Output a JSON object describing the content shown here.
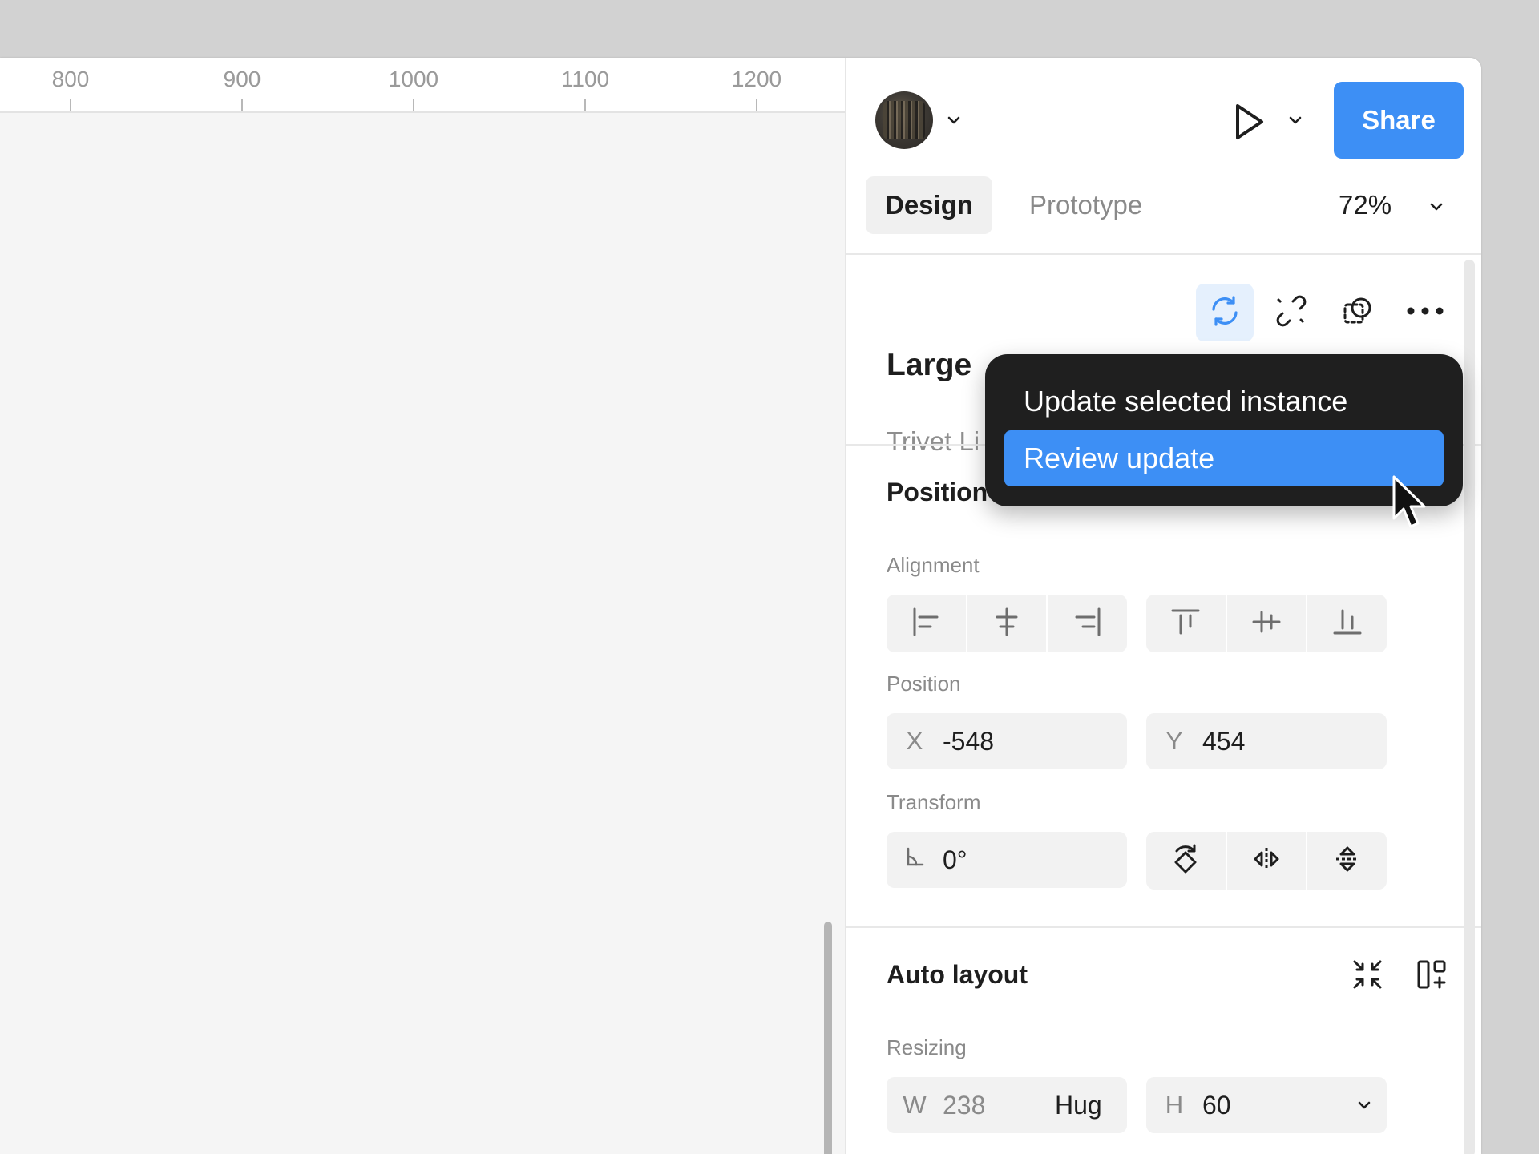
{
  "ruler": {
    "ticks": [
      "800",
      "900",
      "1000",
      "1100",
      "1200"
    ]
  },
  "header": {
    "share_label": "Share",
    "tabs": [
      {
        "label": "Design",
        "active": true
      },
      {
        "label": "Prototype",
        "active": false
      }
    ],
    "zoom": "72%"
  },
  "component": {
    "name": "Large",
    "library_text": "Trivet Li"
  },
  "menu": {
    "items": [
      {
        "label": "Update selected instance",
        "highlighted": false
      },
      {
        "label": "Review update",
        "highlighted": true
      }
    ]
  },
  "position_section": {
    "title": "Position",
    "alignment_label": "Alignment",
    "position_label": "Position",
    "x_prefix": "X",
    "x_value": "-548",
    "y_prefix": "Y",
    "y_value": "454",
    "transform_label": "Transform",
    "rotation_value": "0°"
  },
  "auto_layout": {
    "title": "Auto layout",
    "resizing_label": "Resizing",
    "w_prefix": "W",
    "w_value": "238",
    "w_mode": "Hug",
    "h_prefix": "H",
    "h_value": "60"
  },
  "colors": {
    "accent": "#3d8ff5",
    "menu_bg": "#1f1f1f",
    "active_icon_bg": "#e5f0fd"
  }
}
